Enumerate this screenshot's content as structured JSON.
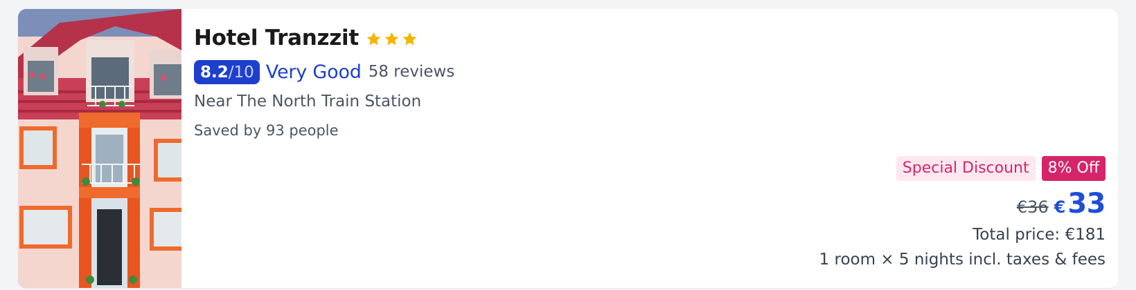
{
  "hotel": {
    "name": "Hotel Tranzzit",
    "star_count": 3,
    "star_icon": "star-icon",
    "photo_icon": "hotel-photo",
    "score": "8.2",
    "score_max": "/10",
    "rating_label": "Very Good",
    "reviews": "58 reviews",
    "location": "Near The North Train Station",
    "saved": "Saved by 93 people"
  },
  "pricing": {
    "special_label": "Special Discount",
    "discount_label": "8% Off",
    "old_price": "€36",
    "currency": "€",
    "new_price": "33",
    "total": "Total price: €181",
    "stay_details": "1 room × 5 nights incl. taxes & fees"
  },
  "colors": {
    "accent_blue": "#1d4ed8",
    "score_badge": "#1d3fcc",
    "discount_pink": "#d6246a",
    "special_bg": "#fde8ef",
    "star_gold": "#f5b400"
  }
}
